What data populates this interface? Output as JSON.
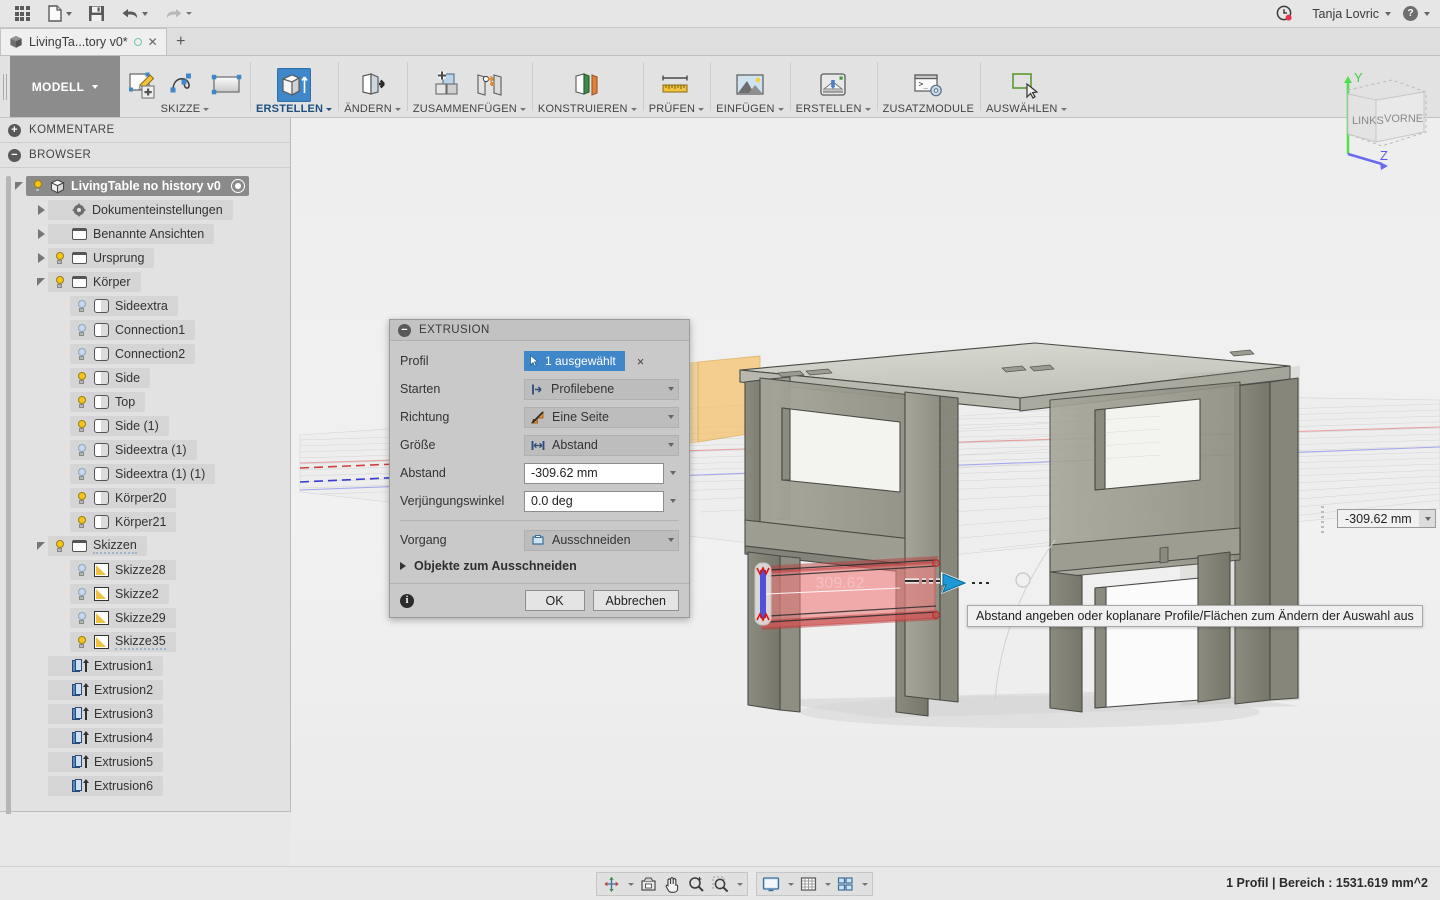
{
  "appbar": {
    "apps_icon": "grid-apps-icon",
    "file_label": "file-icon",
    "save_label": "save-icon",
    "undo_label": "undo-icon",
    "redo_label": "redo-icon",
    "notifications_icon": "clock-notification-icon",
    "user_name": "Tanja Lovric",
    "help_icon": "help-icon"
  },
  "tabs": {
    "items": [
      {
        "label": "LivingTa...tory v0*",
        "icon": "document-cube-icon",
        "modified": true
      }
    ],
    "new_tab_label": "+"
  },
  "ribbon": {
    "workspace": "MODELL",
    "groups": [
      {
        "label": "SKIZZE",
        "has_caret": true,
        "tools": [
          "create-sketch-icon",
          "spline-icon",
          "rectangle-icon"
        ]
      },
      {
        "label": "ERSTELLEN",
        "has_caret": true,
        "active": true,
        "tools": [
          "extrude-icon"
        ]
      },
      {
        "label": "ÄNDERN",
        "has_caret": true,
        "tools": [
          "press-pull-icon"
        ]
      },
      {
        "label": "ZUSAMMENFÜGEN",
        "has_caret": true,
        "tools": [
          "new-component-icon",
          "joint-icon"
        ]
      },
      {
        "label": "KONSTRUIEREN",
        "has_caret": true,
        "tools": [
          "construct-plane-icon"
        ]
      },
      {
        "label": "PRÜFEN",
        "has_caret": true,
        "tools": [
          "measure-icon"
        ]
      },
      {
        "label": "EINFÜGEN",
        "has_caret": true,
        "tools": [
          "insert-image-icon"
        ]
      },
      {
        "label": "ERSTELLEN",
        "has_caret": true,
        "tools": [
          "make-3dprint-icon"
        ]
      },
      {
        "label": "ZUSATZMODULE",
        "has_caret": false,
        "tools": [
          "addins-script-icon"
        ]
      },
      {
        "label": "AUSWÄHLEN",
        "has_caret": true,
        "tools": [
          "select-icon"
        ]
      }
    ]
  },
  "left_panel": {
    "comments_header": "KOMMENTARE",
    "browser_header": "BROWSER",
    "tree": [
      {
        "label": "LivingTable no history v0",
        "indent": 0,
        "toggle": "down",
        "bulb": "on",
        "icon": "document-cube-icon",
        "root": true,
        "radio": true
      },
      {
        "label": "Dokumenteinstellungen",
        "indent": 1,
        "toggle": "right",
        "bulb": "none",
        "icon": "gear-icon"
      },
      {
        "label": "Benannte Ansichten",
        "indent": 1,
        "toggle": "right",
        "bulb": "none",
        "icon": "folder-icon"
      },
      {
        "label": "Ursprung",
        "indent": 1,
        "toggle": "right",
        "bulb": "on",
        "icon": "folder-icon"
      },
      {
        "label": "Körper",
        "indent": 1,
        "toggle": "down",
        "bulb": "on",
        "icon": "folder-icon"
      },
      {
        "label": "Sideextra",
        "indent": 2,
        "toggle": "none",
        "bulb": "off",
        "icon": "body-icon"
      },
      {
        "label": "Connection1",
        "indent": 2,
        "toggle": "none",
        "bulb": "off",
        "icon": "body-icon"
      },
      {
        "label": "Connection2",
        "indent": 2,
        "toggle": "none",
        "bulb": "off",
        "icon": "body-icon"
      },
      {
        "label": "Side",
        "indent": 2,
        "toggle": "none",
        "bulb": "on",
        "icon": "body-icon"
      },
      {
        "label": "Top",
        "indent": 2,
        "toggle": "none",
        "bulb": "on",
        "icon": "body-icon"
      },
      {
        "label": "Side (1)",
        "indent": 2,
        "toggle": "none",
        "bulb": "on",
        "icon": "body-icon"
      },
      {
        "label": "Sideextra (1)",
        "indent": 2,
        "toggle": "none",
        "bulb": "off",
        "icon": "body-icon"
      },
      {
        "label": "Sideextra (1) (1)",
        "indent": 2,
        "toggle": "none",
        "bulb": "off",
        "icon": "body-icon"
      },
      {
        "label": "Körper20",
        "indent": 2,
        "toggle": "none",
        "bulb": "on",
        "icon": "body-icon"
      },
      {
        "label": "Körper21",
        "indent": 2,
        "toggle": "none",
        "bulb": "on",
        "icon": "body-icon"
      },
      {
        "label": "Skizzen",
        "indent": 1,
        "toggle": "down",
        "bulb": "on",
        "icon": "folder-icon",
        "dotted": true
      },
      {
        "label": "Skizze28",
        "indent": 2,
        "toggle": "none",
        "bulb": "off",
        "icon": "sketch-icon"
      },
      {
        "label": "Skizze2",
        "indent": 2,
        "toggle": "none",
        "bulb": "off",
        "icon": "sketch-icon"
      },
      {
        "label": "Skizze29",
        "indent": 2,
        "toggle": "none",
        "bulb": "off",
        "icon": "sketch-icon"
      },
      {
        "label": "Skizze35",
        "indent": 2,
        "toggle": "none",
        "bulb": "on",
        "icon": "sketch-icon",
        "dotted": true
      },
      {
        "label": "Extrusion1",
        "indent": 1,
        "toggle": "none",
        "bulb": "none",
        "icon": "extrusion-icon"
      },
      {
        "label": "Extrusion2",
        "indent": 1,
        "toggle": "none",
        "bulb": "none",
        "icon": "extrusion-icon"
      },
      {
        "label": "Extrusion3",
        "indent": 1,
        "toggle": "none",
        "bulb": "none",
        "icon": "extrusion-icon"
      },
      {
        "label": "Extrusion4",
        "indent": 1,
        "toggle": "none",
        "bulb": "none",
        "icon": "extrusion-icon"
      },
      {
        "label": "Extrusion5",
        "indent": 1,
        "toggle": "none",
        "bulb": "none",
        "icon": "extrusion-icon"
      },
      {
        "label": "Extrusion6",
        "indent": 1,
        "toggle": "none",
        "bulb": "none",
        "icon": "extrusion-icon"
      }
    ]
  },
  "dialog": {
    "title": "EXTRUSION",
    "collapse_icon": "collapse-icon",
    "rows": {
      "profile_label": "Profil",
      "profile_value": "1 ausgewählt",
      "profile_clear": "×",
      "start_label": "Starten",
      "start_value": "Profilebene",
      "direction_label": "Richtung",
      "direction_value": "Eine Seite",
      "extent_label": "Größe",
      "extent_value": "Abstand",
      "distance_label": "Abstand",
      "distance_value": "-309.62 mm",
      "taper_label": "Verjüngungswinkel",
      "taper_value": "0.0 deg",
      "operation_label": "Vorgang",
      "operation_value": "Ausschneiden",
      "objects_label": "Objekte zum Ausschneiden"
    },
    "ok_label": "OK",
    "cancel_label": "Abbrechen",
    "info_icon": "info-icon"
  },
  "viewport": {
    "manipulator_value": "-309.62 mm",
    "dimension_label": "309.62",
    "tooltip": "Abstand angeben oder koplanare Profile/Flächen zum Ändern der Auswahl aus",
    "viewcube": {
      "face_left": "LINKS",
      "face_front": "VORNE",
      "axis_y": "Y",
      "axis_z": "Z",
      "color_y": "#55dd55",
      "color_z": "#6a6aee"
    },
    "colors": {
      "preview_fill": "#f08080",
      "manipulator": "#1d9ad6",
      "body": "#9a9a8e",
      "plane": "#f0c070"
    }
  },
  "navbar": {
    "groups": [
      {
        "buttons": [
          "orbit-icon",
          "look-at-icon",
          "pan-icon",
          "zoom-icon",
          "zoom-window-icon"
        ]
      },
      {
        "buttons": [
          "display-settings-icon",
          "grid-snap-icon",
          "viewports-icon"
        ]
      }
    ]
  },
  "status": {
    "text": "1 Profil | Bereich : 1531.619 mm^2"
  }
}
